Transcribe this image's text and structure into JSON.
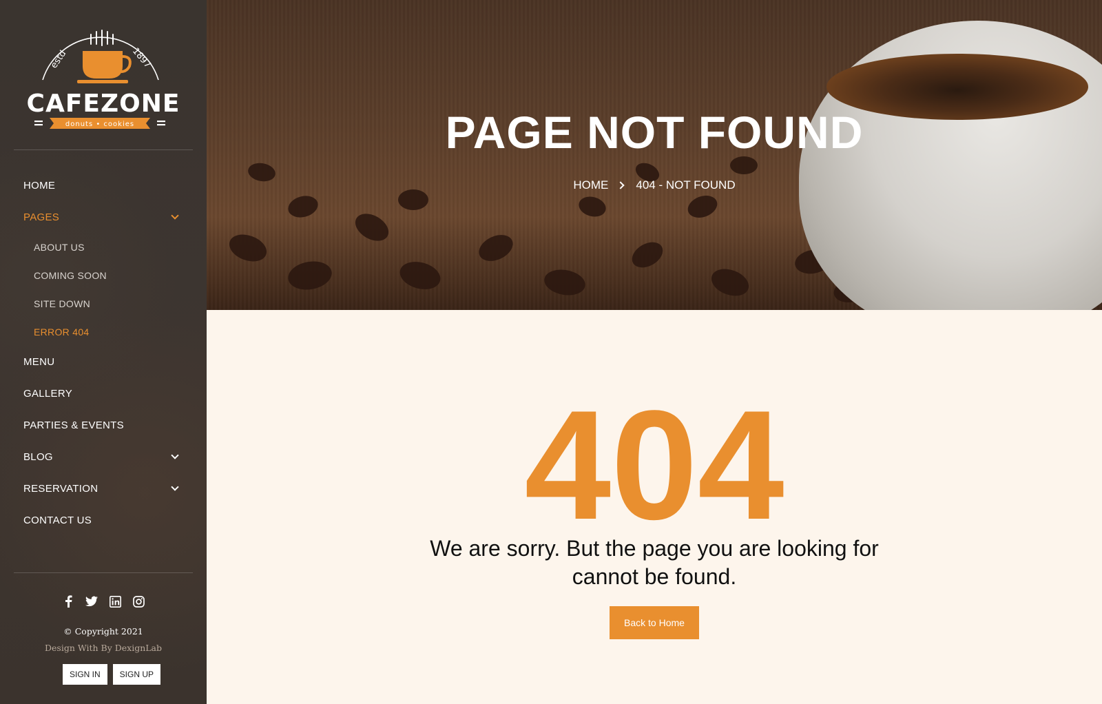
{
  "brand": {
    "name": "CAFEZONE",
    "estd": "estd",
    "year": "1897",
    "tagline": "donuts • cookies",
    "accent": "#e98f2f"
  },
  "sidebar": {
    "nav": [
      {
        "label": "HOME"
      },
      {
        "label": "PAGES",
        "active": true,
        "expanded": true
      },
      {
        "label": "MENU"
      },
      {
        "label": "GALLERY"
      },
      {
        "label": "PARTIES & EVENTS"
      },
      {
        "label": "BLOG",
        "has_submenu": true
      },
      {
        "label": "RESERVATION",
        "has_submenu": true
      },
      {
        "label": "CONTACT US"
      }
    ],
    "pages_submenu": [
      {
        "label": "ABOUT US"
      },
      {
        "label": "COMING SOON"
      },
      {
        "label": "SITE DOWN"
      },
      {
        "label": "ERROR 404",
        "active": true
      }
    ],
    "social_icons": [
      "facebook-icon",
      "twitter-icon",
      "linkedin-icon",
      "instagram-icon"
    ],
    "copyright": "© Copyright 2021",
    "design_credit": "Design With By DexignLab",
    "sign_in": "SIGN IN",
    "sign_up": "SIGN UP"
  },
  "hero": {
    "title": "PAGE NOT FOUND",
    "breadcrumb": [
      "HOME",
      "404 - NOT FOUND"
    ]
  },
  "main": {
    "code": "404",
    "message_line1": "We are sorry. But the page you are looking for",
    "message_line2": "cannot be found.",
    "button": "Back to Home"
  }
}
